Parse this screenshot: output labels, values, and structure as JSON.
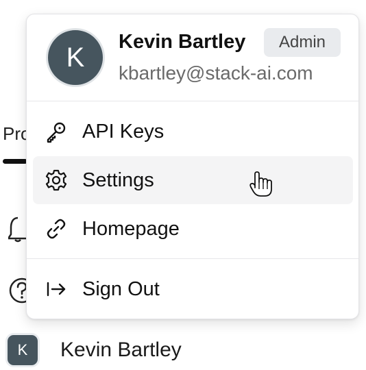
{
  "background": {
    "sidebar_partial_label": "Pro",
    "footer_user": {
      "avatar_letter": "K",
      "name": "Kevin Bartley"
    }
  },
  "menu": {
    "user": {
      "avatar_letter": "K",
      "name": "Kevin Bartley",
      "role": "Admin",
      "email": "kbartley@stack-ai.com"
    },
    "items": [
      {
        "label": "API Keys",
        "icon": "key-icon"
      },
      {
        "label": "Settings",
        "icon": "gear-icon",
        "hovered": true
      },
      {
        "label": "Homepage",
        "icon": "link-icon"
      },
      {
        "label": "Sign Out",
        "icon": "sign-out-icon"
      }
    ]
  },
  "colors": {
    "avatar_bg": "#46555e",
    "badge_bg": "#e9ebee",
    "hover_bg": "#f4f4f5"
  }
}
